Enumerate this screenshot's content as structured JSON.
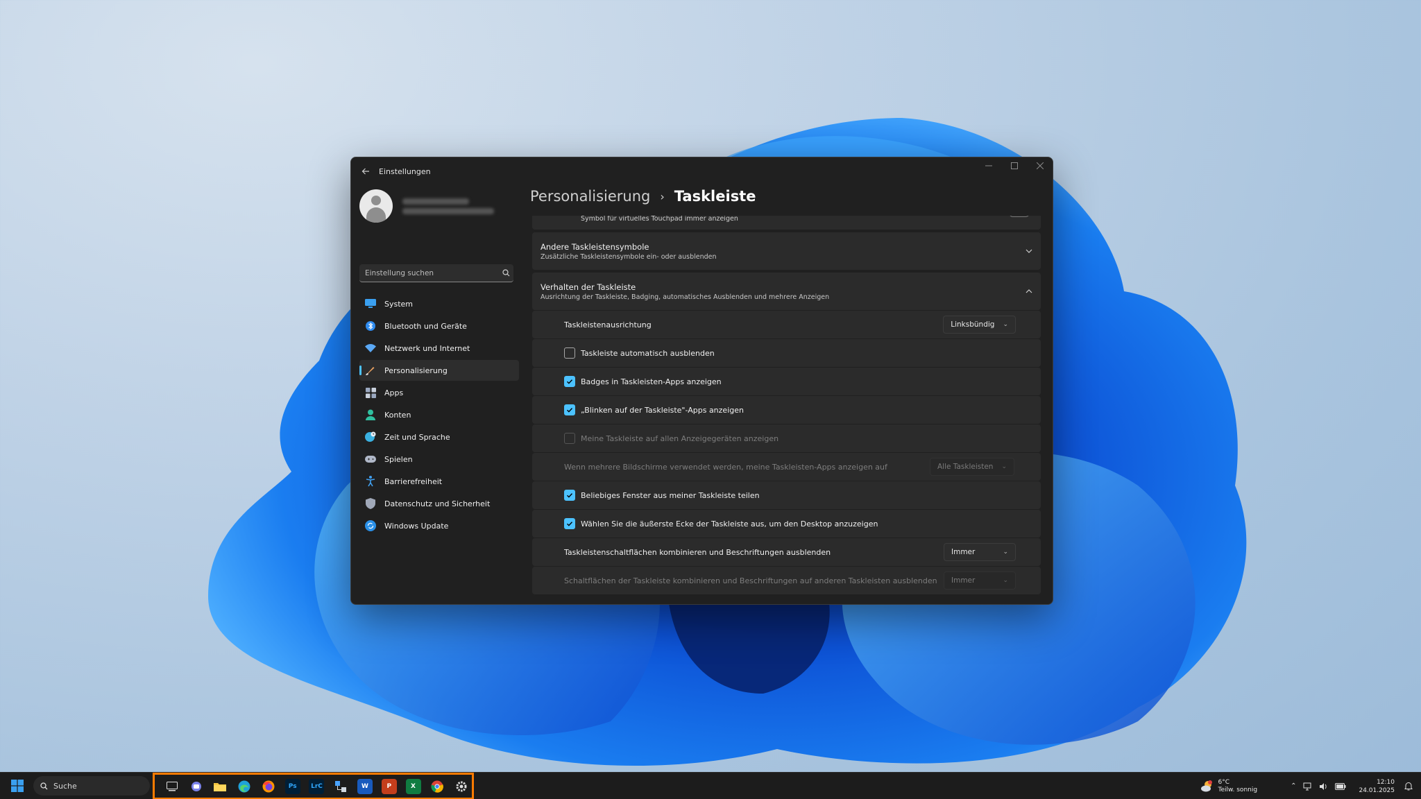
{
  "window": {
    "app_title": "Einstellungen"
  },
  "sidebar": {
    "search_placeholder": "Einstellung suchen",
    "items": [
      {
        "label": "System",
        "icon": "monitor-icon",
        "color": "#3aa0f0"
      },
      {
        "label": "Bluetooth und Geräte",
        "icon": "bluetooth-icon",
        "color": "#2f8cf0"
      },
      {
        "label": "Netzwerk und Internet",
        "icon": "wifi-icon",
        "color": "#5aa8f5"
      },
      {
        "label": "Personalisierung",
        "icon": "brush-icon",
        "color": "#e8a060",
        "active": true
      },
      {
        "label": "Apps",
        "icon": "apps-icon",
        "color": "#9aa8c0"
      },
      {
        "label": "Konten",
        "icon": "person-icon",
        "color": "#30c0a0"
      },
      {
        "label": "Zeit und Sprache",
        "icon": "globe-clock-icon",
        "color": "#3ab0e0"
      },
      {
        "label": "Spielen",
        "icon": "gamepad-icon",
        "color": "#b0b8c8"
      },
      {
        "label": "Barrierefreiheit",
        "icon": "accessibility-icon",
        "color": "#40a0f0"
      },
      {
        "label": "Datenschutz und Sicherheit",
        "icon": "shield-icon",
        "color": "#a0a8b8"
      },
      {
        "label": "Windows Update",
        "icon": "update-icon",
        "color": "#2a90e8"
      }
    ]
  },
  "breadcrumb": {
    "parent": "Personalisierung",
    "separator": "›",
    "current": "Taskleiste"
  },
  "content": {
    "top_partial_text": "Symbol für virtuelles Touchpad immer anzeigen",
    "other_icons": {
      "title": "Andere Taskleistensymbole",
      "subtitle": "Zusätzliche Taskleistensymbole ein- oder ausblenden"
    },
    "behavior": {
      "title": "Verhalten der Taskleiste",
      "subtitle": "Ausrichtung der Taskleiste, Badging, automatisches Ausblenden und mehrere Anzeigen",
      "alignment_label": "Taskleistenausrichtung",
      "alignment_value": "Linksbündig",
      "autohide_label": "Taskleiste automatisch ausblenden",
      "autohide_checked": false,
      "badges_label": "Badges in Taskleisten-Apps anzeigen",
      "badges_checked": true,
      "flashing_label": "„Blinken auf der Taskleiste\"-Apps anzeigen",
      "flashing_checked": true,
      "all_displays_label": "Meine Taskleiste auf allen Anzeigegeräten anzeigen",
      "all_displays_checked": false,
      "multi_screen_label": "Wenn mehrere Bildschirme verwendet werden, meine Taskleisten-Apps anzeigen auf",
      "multi_screen_value": "Alle Taskleisten",
      "share_window_label": "Beliebiges Fenster aus meiner Taskleiste teilen",
      "share_window_checked": true,
      "far_corner_label": "Wählen Sie die äußerste Ecke der Taskleiste aus, um den Desktop anzuzeigen",
      "far_corner_checked": true,
      "combine_label": "Taskleistenschaltflächen kombinieren und Beschriftungen ausblenden",
      "combine_value": "Immer",
      "combine_other_label": "Schaltflächen der Taskleiste kombinieren und Beschriftungen auf anderen Taskleisten ausblenden",
      "combine_other_value": "Immer"
    }
  },
  "taskbar": {
    "search_label": "Suche",
    "apps": [
      {
        "name": "task-view-icon",
        "label": "",
        "bg": "#3a3a3a",
        "fg": "#e0e0e0"
      },
      {
        "name": "teams-icon",
        "label": "",
        "bg": "#5b5fc7",
        "fg": "#fff"
      },
      {
        "name": "file-explorer-icon",
        "label": "",
        "bg": "#f4c542",
        "fg": "#7a5a00"
      },
      {
        "name": "edge-icon",
        "label": "",
        "bg": "#1fa2d8",
        "fg": "#fff"
      },
      {
        "name": "firefox-icon",
        "label": "",
        "bg": "#ff6a2a",
        "fg": "#fff"
      },
      {
        "name": "photoshop-icon",
        "label": "Ps",
        "bg": "#001e36",
        "fg": "#31a8ff"
      },
      {
        "name": "lightroom-classic-icon",
        "label": "LrC",
        "bg": "#001e36",
        "fg": "#31a8ff"
      },
      {
        "name": "network-app-icon",
        "label": "",
        "bg": "#2e6db5",
        "fg": "#fff"
      },
      {
        "name": "word-icon",
        "label": "W",
        "bg": "#185abd",
        "fg": "#fff"
      },
      {
        "name": "powerpoint-icon",
        "label": "P",
        "bg": "#c43e1c",
        "fg": "#fff"
      },
      {
        "name": "excel-icon",
        "label": "X",
        "bg": "#107c41",
        "fg": "#fff"
      },
      {
        "name": "chrome-icon",
        "label": "",
        "bg": "#ffffff",
        "fg": "#4285f4"
      },
      {
        "name": "settings-app-icon",
        "label": "",
        "bg": "#4a4a4a",
        "fg": "#ddd"
      }
    ],
    "highlight_color": "#ff7b00",
    "weather_temp": "6°C",
    "weather_desc": "Teilw. sonnig",
    "time": "12:10",
    "date": "24.01.2025"
  }
}
